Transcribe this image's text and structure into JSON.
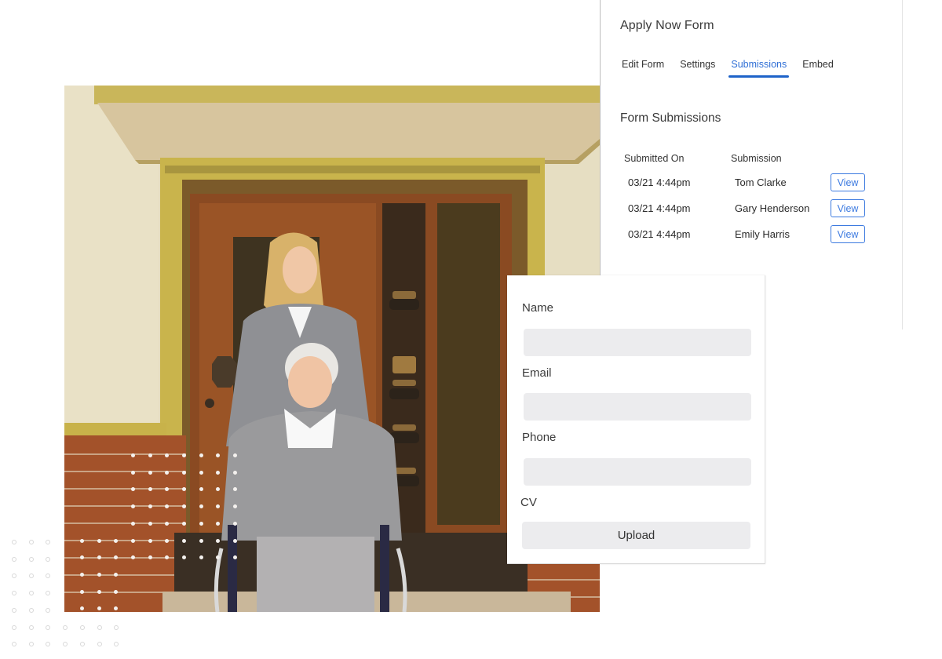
{
  "panel": {
    "title": "Apply Now Form",
    "tabs": [
      {
        "label": "Edit Form",
        "active": false
      },
      {
        "label": "Settings",
        "active": false
      },
      {
        "label": "Submissions",
        "active": true
      },
      {
        "label": "Embed",
        "active": false
      }
    ],
    "section_title": "Form Submissions",
    "columns": [
      "Submitted On",
      "Submission"
    ],
    "rows": [
      {
        "date": "03/21 4:44pm",
        "name": "Tom Clarke",
        "action": "View"
      },
      {
        "date": "03/21 4:44pm",
        "name": "Gary Henderson",
        "action": "View"
      },
      {
        "date": "03/21 4:44pm",
        "name": "Emily Harris",
        "action": "View"
      }
    ],
    "accent_color": "#1e63c9"
  },
  "form": {
    "fields": [
      {
        "label": "Name",
        "value": "",
        "placeholder": ""
      },
      {
        "label": "Email",
        "value": "",
        "placeholder": ""
      },
      {
        "label": "Phone",
        "value": "",
        "placeholder": ""
      }
    ],
    "cv_label": "CV",
    "upload_label": "Upload"
  },
  "photo": {
    "description": "Smiling caregiver standing behind a smiling elderly woman in a wheelchair in front of a wooden front door"
  }
}
